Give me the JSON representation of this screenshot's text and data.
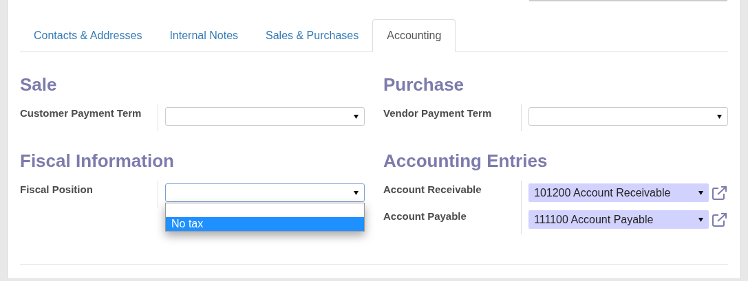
{
  "tabs": [
    {
      "label": "Contacts & Addresses",
      "selected": false
    },
    {
      "label": "Internal Notes",
      "selected": false
    },
    {
      "label": "Sales & Purchases",
      "selected": false
    },
    {
      "label": "Accounting",
      "selected": true
    }
  ],
  "columns": [
    {
      "groups": [
        {
          "title": "Sale",
          "fields": [
            {
              "label": "Customer Payment Term",
              "kind": "select"
            }
          ]
        },
        {
          "title": "Fiscal Information",
          "fields": [
            {
              "label": "Fiscal Position",
              "kind": "select",
              "focused": true,
              "dropdown": [
                {
                  "label": "No tax",
                  "selected": true
                }
              ]
            }
          ]
        }
      ]
    },
    {
      "groups": [
        {
          "title": "Purchase",
          "fields": [
            {
              "label": "Vendor Payment Term",
              "kind": "select"
            }
          ]
        },
        {
          "title": "Accounting Entries",
          "fields": [
            {
              "label": "Account Receivable",
              "value": "101200 Account Receivable",
              "kind": "many2one"
            },
            {
              "label": "Account Payable",
              "value": "111100 Account Payable",
              "kind": "many2one"
            }
          ]
        }
      ]
    }
  ]
}
